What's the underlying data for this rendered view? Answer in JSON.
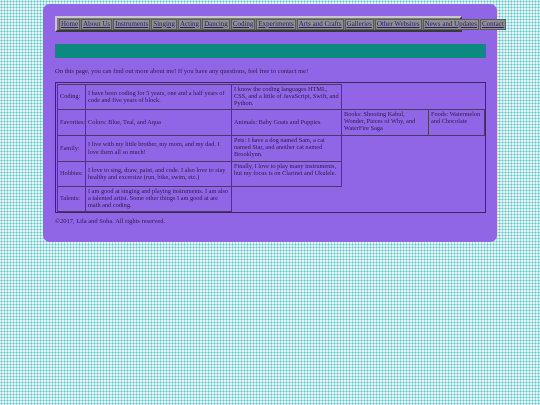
{
  "nav": {
    "items": [
      {
        "label": "Home"
      },
      {
        "label": "About Us"
      },
      {
        "label": "Instruments"
      },
      {
        "label": "Singing"
      },
      {
        "label": "Acting"
      },
      {
        "label": "Dancing"
      },
      {
        "label": "Coding"
      },
      {
        "label": "Experiments"
      },
      {
        "label": "Arts and Crafts"
      },
      {
        "label": "Galleries"
      },
      {
        "label": "Other Websites"
      },
      {
        "label": "News and Updates"
      },
      {
        "label": "Contact"
      }
    ]
  },
  "intro": "On this page, you can find out more about me! If you have any questions, feel free to contact me!",
  "info": {
    "coding_label": "Coding:",
    "coding_years": "I have been coding for 5 years, one and a half years of code and five years of block.",
    "coding_languages": "I know the coding languages HTML, CSS, and a little of JavaScript, Swift, and Python.",
    "favorites_label": "Favorites:",
    "fav_colors": "Colors: Blue, Teal, and Aqua",
    "fav_animals": "Animals: Baby Goats and Puppies",
    "fav_books": "Books: Shooting Kabul, Wonder, Pieces of Why, and WaterFire Saga",
    "fav_foods": "Foods: Watermelon and Chocolate",
    "family_label": "Family:",
    "family_text": "I live with my little brother, my mom, and my dad. I love them all so much!",
    "pets_text": "Pets: I have a dog named Sam, a cat named Star, and another cat named Brooklynn.",
    "hobbies_label": "Hobbies:",
    "hobbies_text": "I love to sing, draw, paint, and code. I also love to stay healthy and excersize (run, bike, swim, etc.)",
    "instruments_text": "Finally, I love to play many instruments, but my focus is on Clarinet and Ukulele.",
    "talents_label": "Talents:",
    "talents_text": "I am good at singing and playing instruments. I am also a talented artist. Some other things I am good at are math and coding."
  },
  "footer": "©2017, Lila and Soha. All rights reserved.",
  "colors": {
    "card": "#9066e6",
    "banner": "#0d8a80",
    "nav": "#7a7a7a"
  }
}
